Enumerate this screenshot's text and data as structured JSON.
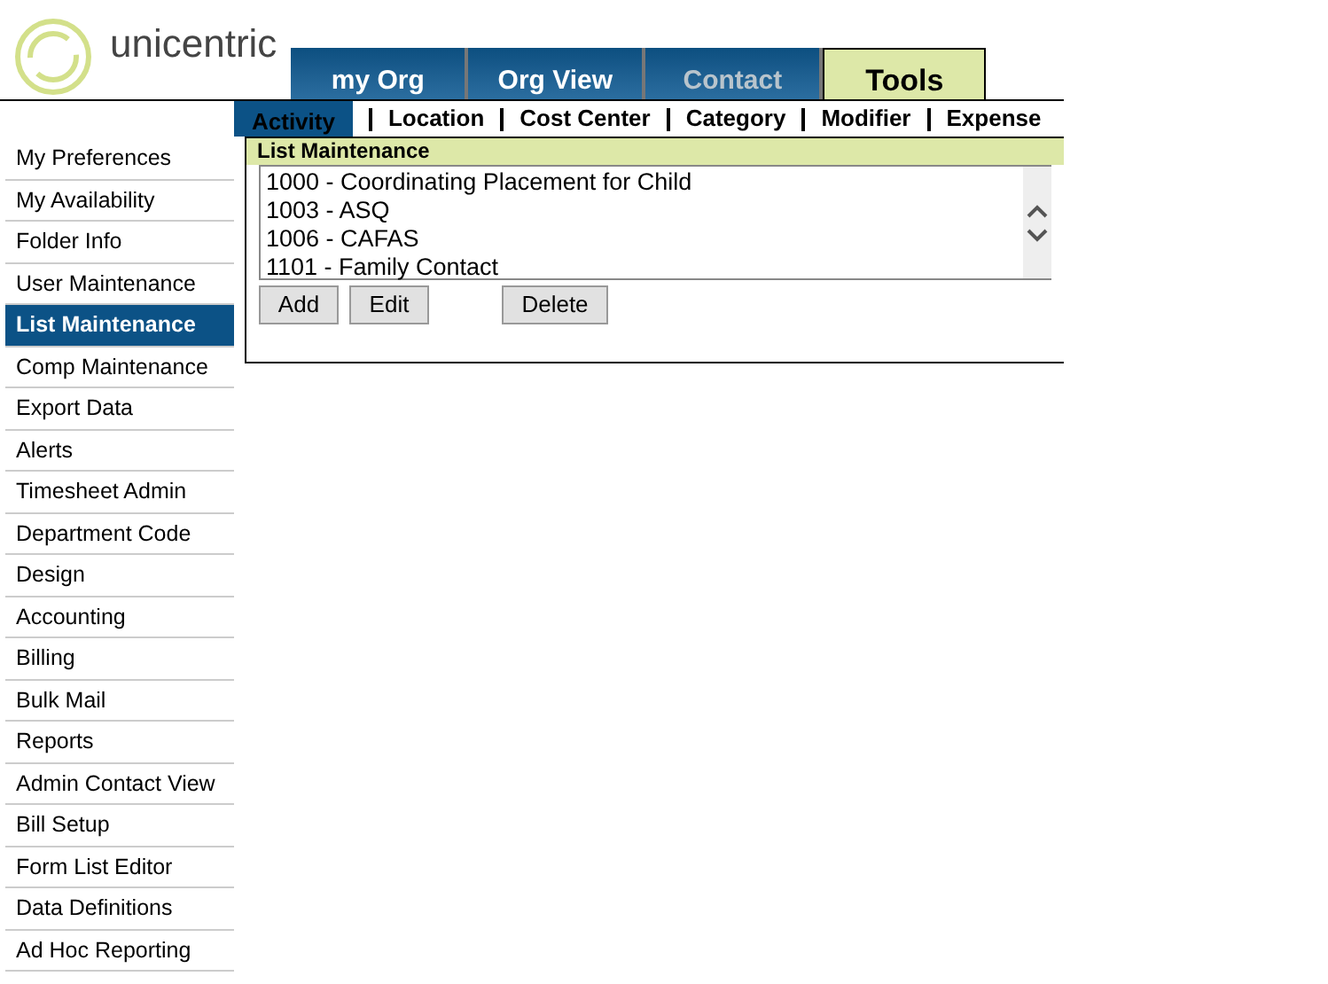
{
  "logo": {
    "text": "unicentric"
  },
  "tabs": [
    {
      "label": "my Org",
      "selected": false,
      "disabled": false
    },
    {
      "label": "Org View",
      "selected": false,
      "disabled": false
    },
    {
      "label": "Contact",
      "selected": false,
      "disabled": true
    },
    {
      "label": "Tools",
      "selected": true,
      "disabled": false
    }
  ],
  "subnav": [
    {
      "label": "Activity",
      "selected": true
    },
    {
      "label": "Location",
      "selected": false
    },
    {
      "label": "Cost Center",
      "selected": false
    },
    {
      "label": "Category",
      "selected": false
    },
    {
      "label": "Modifier",
      "selected": false
    },
    {
      "label": "Expense",
      "selected": false
    }
  ],
  "sidebar": {
    "items": [
      {
        "label": "My Preferences",
        "selected": false
      },
      {
        "label": "My Availability",
        "selected": false
      },
      {
        "label": "Folder Info",
        "selected": false
      },
      {
        "label": "User Maintenance",
        "selected": false
      },
      {
        "label": "List Maintenance",
        "selected": true
      },
      {
        "label": "Comp Maintenance",
        "selected": false
      },
      {
        "label": "Export Data",
        "selected": false
      },
      {
        "label": "Alerts",
        "selected": false
      },
      {
        "label": "Timesheet Admin",
        "selected": false
      },
      {
        "label": "Department Code",
        "selected": false
      },
      {
        "label": "Design",
        "selected": false
      },
      {
        "label": "Accounting",
        "selected": false
      },
      {
        "label": "Billing",
        "selected": false
      },
      {
        "label": "Bulk Mail",
        "selected": false
      },
      {
        "label": "Reports",
        "selected": false
      },
      {
        "label": "Admin Contact View",
        "selected": false
      },
      {
        "label": "Bill Setup",
        "selected": false
      },
      {
        "label": "Form List Editor",
        "selected": false
      },
      {
        "label": "Data Definitions",
        "selected": false
      },
      {
        "label": "Ad Hoc Reporting",
        "selected": false
      }
    ]
  },
  "panel": {
    "title": "List Maintenance",
    "items": [
      "1000 - Coordinating Placement for Child",
      "1003 - ASQ",
      "1006 - CAFAS",
      "1101 - Family Contact"
    ],
    "buttons": [
      "Add",
      "Edit",
      "Delete"
    ]
  }
}
